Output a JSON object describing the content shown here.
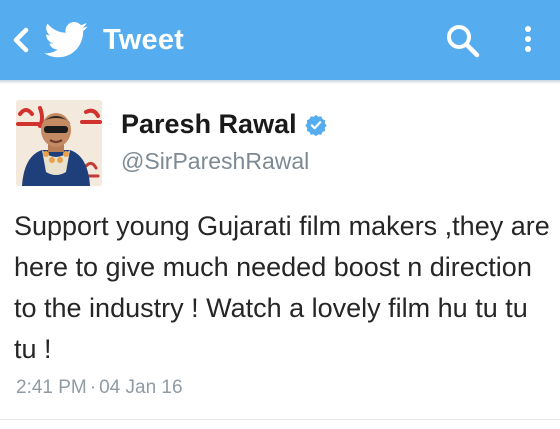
{
  "appbar": {
    "title": "Tweet",
    "background_color": "#55acee",
    "icons": [
      "chevron-left-icon",
      "twitter-bird-icon",
      "search-icon",
      "more-vertical-icon"
    ]
  },
  "tweet": {
    "author": {
      "display_name": "Paresh Rawal",
      "handle": "@SirPareshRawal",
      "verified": true,
      "verified_color": "#55acee"
    },
    "text": "Support young Gujarati film makers ,they are here to give much needed boost n direction to the industry ! Watch a lovely film hu tu tu tu !",
    "time": "2:41 PM",
    "separator": "·",
    "date": "04 Jan 16"
  }
}
